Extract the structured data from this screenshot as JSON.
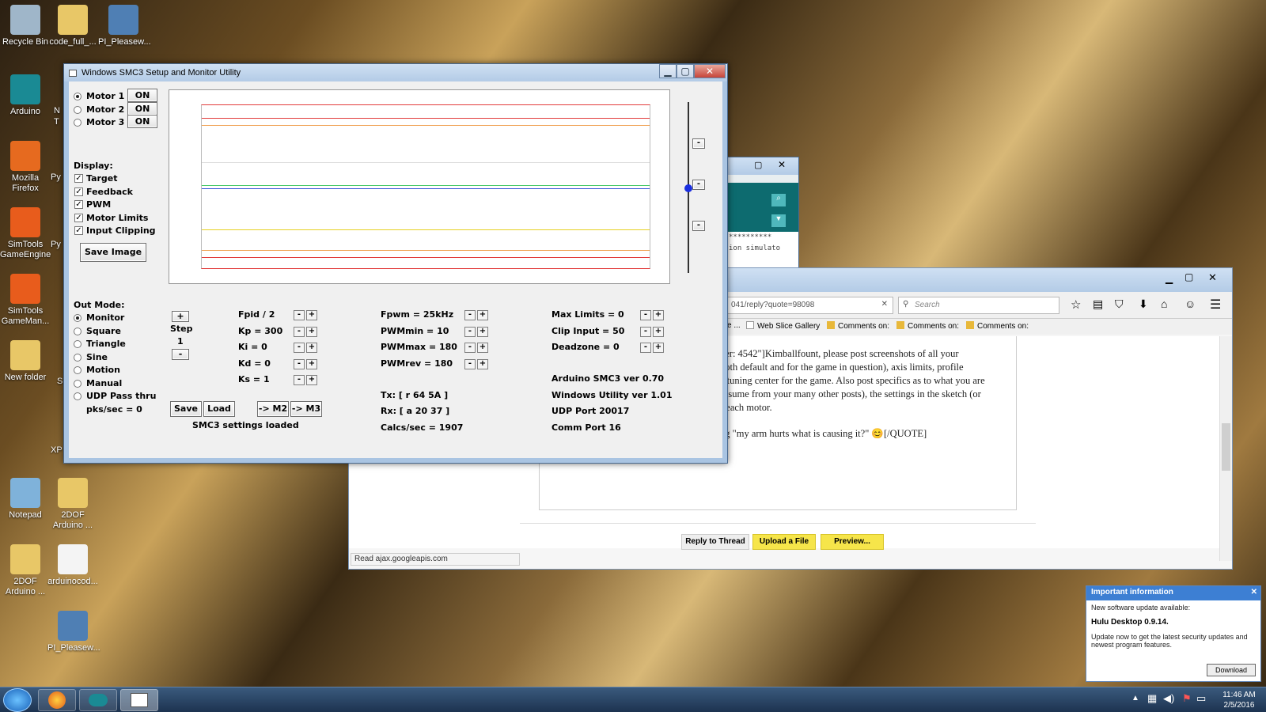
{
  "desktop": {
    "icons": [
      {
        "label": "Recycle Bin",
        "color": "#9fb6c9"
      },
      {
        "label": "code_full_...",
        "color": "#e8c767"
      },
      {
        "label": "PI_Pleasew...",
        "color": "#4f7fb4"
      },
      {
        "label": "Arduino",
        "color": "#1a8a94"
      },
      {
        "label": "Mozilla Firefox",
        "color": "#e66a1f"
      },
      {
        "label": "SimTools GameEngine",
        "color": "#e85c1c"
      },
      {
        "label": "SimTools GameMan...",
        "color": "#e85c1c"
      },
      {
        "label": "New folder",
        "color": "#e8c767"
      },
      {
        "label": "Notepad",
        "color": "#7fb2da"
      },
      {
        "label": "2DOF Arduino ...",
        "color": "#e8c767"
      },
      {
        "label": "2DOF Arduino ...",
        "color": "#e8c767"
      },
      {
        "label": "arduinocod...",
        "color": "#f4f4f4"
      },
      {
        "label": "PI_Pleasew...",
        "color": "#4f7fb4"
      }
    ],
    "partial": [
      "N",
      "T",
      "Py",
      "Py",
      "S",
      "XP"
    ]
  },
  "smc3": {
    "title": "Windows SMC3 Setup and Monitor Utility",
    "motors": [
      {
        "label": "Motor 1",
        "btn": "ON",
        "selected": true
      },
      {
        "label": "Motor 2",
        "btn": "ON",
        "selected": false
      },
      {
        "label": "Motor 3",
        "btn": "ON",
        "selected": false
      }
    ],
    "display_label": "Display:",
    "display_opts": [
      "Target",
      "Feedback",
      "PWM",
      "Motor Limits",
      "Input Clipping"
    ],
    "save_image": "Save Image",
    "out_mode_label": "Out Mode:",
    "out_modes": [
      {
        "label": "Monitor",
        "selected": true
      },
      {
        "label": "Square",
        "selected": false
      },
      {
        "label": "Triangle",
        "selected": false
      },
      {
        "label": "Sine",
        "selected": false
      },
      {
        "label": "Motion",
        "selected": false
      },
      {
        "label": "Manual",
        "selected": false
      },
      {
        "label": "UDP Pass thru",
        "selected": false
      }
    ],
    "pks": "pks/sec = 0",
    "step_label": "Step",
    "step_value": "1",
    "plus": "+",
    "minus": "-",
    "pid": [
      "Fpid / 2",
      "Kp = 300",
      "Ki = 0",
      "Kd = 0",
      "Ks = 1"
    ],
    "pwm": [
      "Fpwm = 25kHz",
      "PWMmin = 10",
      "PWMmax = 180",
      "PWMrev = 180"
    ],
    "limits": [
      "Max Limits = 0",
      "Clip Input = 50",
      "Deadzone = 0"
    ],
    "buttons": {
      "save": "Save",
      "load": "Load",
      "m2": "-> M2",
      "m3": "-> M3"
    },
    "status": "SMC3 settings loaded",
    "tx": "Tx: [ r 64 5A ]",
    "rx": "Rx: [ a 20 37 ]",
    "calcs": "Calcs/sec = 1907",
    "ver_arduino": "Arduino SMC3 ver 0.70",
    "ver_win": "Windows Utility ver 1.01",
    "udp": "UDP Port 20017",
    "comm": "Comm Port 16",
    "slider_btns": [
      "-",
      "-",
      "-"
    ],
    "plot_lines": [
      {
        "y": 0.08,
        "color": "#e23b3b"
      },
      {
        "y": 0.12,
        "color": "#f0a050"
      },
      {
        "y": 0.35,
        "color": "#dddddd"
      },
      {
        "y": 0.49,
        "color": "#49c96a"
      },
      {
        "y": 0.51,
        "color": "#3a55d8"
      },
      {
        "y": 0.76,
        "color": "#e6d020"
      },
      {
        "y": 0.89,
        "color": "#f0a050"
      },
      {
        "y": 0.93,
        "color": "#e23b3b"
      }
    ],
    "slider_value": 0.5
  },
  "arduino_win": {
    "text": "ion simulato",
    "stars": "**********"
  },
  "firefox": {
    "url": "041/reply?quote=98098",
    "search": "Search",
    "bookmarks": [
      "e ...",
      "Web Slice Gallery",
      "Comments on:",
      "Comments on:",
      "Comments on:"
    ],
    "post_lines": [
      "ber: 4542\"]Kimballfount, please post screenshots of all your",
      "both default and for the game in question), axis limits, profile",
      "e tuning center for the game. Also post specifics as to what you are",
      "assume from your many other posts), the settings in the sketch (or",
      "r each motor.",
      "ng \"my arm hurts what is causing it?\" 😊[/QUOTE]"
    ],
    "reply": "Reply to Thread",
    "upload": "Upload a File",
    "preview": "Preview...",
    "statusbar": "Read ajax.googleapis.com"
  },
  "toast": {
    "title": "Important information",
    "line1": "New software update available:",
    "product": "Hulu Desktop 0.9.14.",
    "line2": "Update now to get the latest security updates and newest program features.",
    "button": "Download"
  },
  "tray": {
    "time": "11:46 AM",
    "date": "2/5/2016"
  }
}
